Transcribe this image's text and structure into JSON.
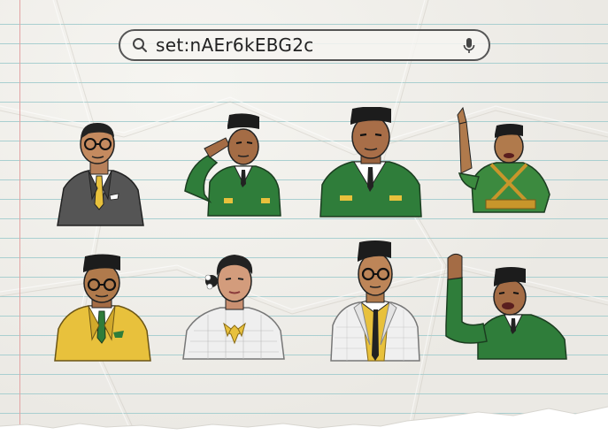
{
  "search": {
    "query": "set:nAEr6kEBG2c",
    "search_icon": "search-icon",
    "mic_icon": "microphone-icon"
  },
  "stickers": [
    {
      "name": "figure-suit-glasses-grey",
      "colors": {
        "suit": "#555555",
        "tie": "#e8c13c"
      }
    },
    {
      "name": "figure-saluting-green",
      "colors": {
        "uniform": "#2f7d3a"
      }
    },
    {
      "name": "figure-peci-green",
      "colors": {
        "uniform": "#2f7d3a"
      }
    },
    {
      "name": "figure-pointing-up-soldier",
      "colors": {
        "uniform": "#3c8a3f",
        "belt": "#c8962b"
      }
    },
    {
      "name": "figure-yellow-suit-glasses",
      "colors": {
        "suit": "#e8c13c",
        "tie": "#2f7d3a"
      }
    },
    {
      "name": "figure-woman-white-kebaya",
      "colors": {
        "kebaya": "#f0f0f0",
        "brooch": "#e8c13c"
      }
    },
    {
      "name": "figure-white-jacket-glasses",
      "colors": {
        "jacket": "#f0f0f0",
        "vest": "#e8c13c"
      }
    },
    {
      "name": "figure-speaking-fist-green",
      "colors": {
        "uniform": "#2f7d3a"
      }
    }
  ]
}
